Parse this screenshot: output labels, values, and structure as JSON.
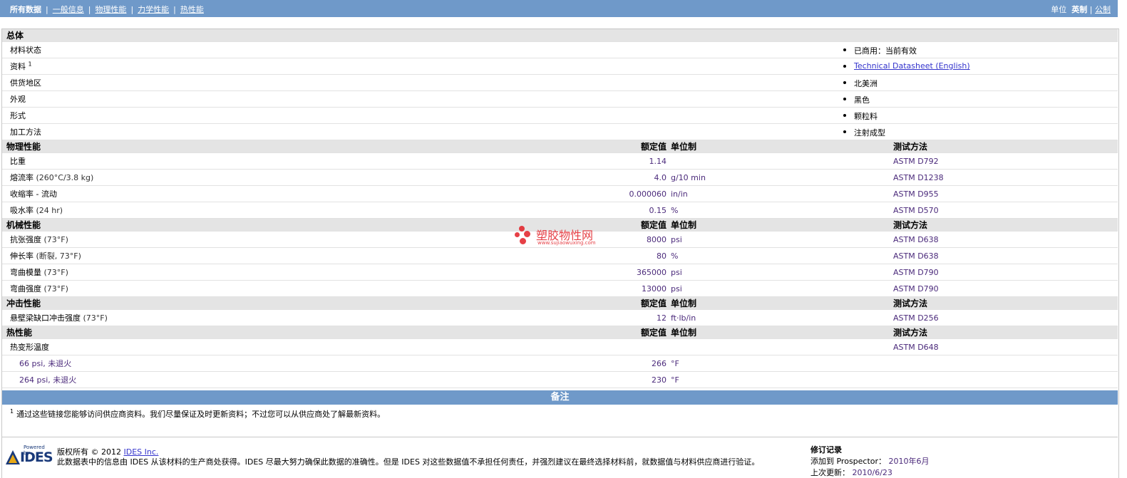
{
  "nav": {
    "items": [
      "所有数据",
      "一般信息",
      "物理性能",
      "力学性能",
      "热性能"
    ]
  },
  "units": {
    "label": "单位",
    "english": "英制",
    "metric": "公制"
  },
  "general": {
    "title": "总体",
    "rows": [
      {
        "label": "材料状态",
        "value": "已商用：当前有效"
      },
      {
        "label": "资料",
        "sup": "1",
        "value": "Technical Datasheet (English)"
      },
      {
        "label": "供货地区",
        "value": "北美洲"
      },
      {
        "label": "外观",
        "value": "黑色"
      },
      {
        "label": "形式",
        "value": "颗粒料"
      },
      {
        "label": "加工方法",
        "value": "注射成型"
      }
    ]
  },
  "headers": {
    "nominal": "额定值",
    "unit": "单位制",
    "method": "测试方法"
  },
  "physical": {
    "title": "物理性能",
    "rows": [
      {
        "label": "比重",
        "cond": "",
        "value": "1.14",
        "unit": "",
        "method": "ASTM D792"
      },
      {
        "label": "熔流率",
        "cond": "(260°C/3.8 kg)",
        "value": "4.0",
        "unit": "g/10 min",
        "method": "ASTM D1238"
      },
      {
        "label": "收缩率",
        "cond": "- 流动",
        "value": "0.000060",
        "unit": "in/in",
        "method": "ASTM D955"
      },
      {
        "label": "吸水率",
        "cond": "(24 hr)",
        "value": "0.15",
        "unit": "%",
        "method": "ASTM D570"
      }
    ]
  },
  "mechanical": {
    "title": "机械性能",
    "rows": [
      {
        "label": "抗张强度",
        "cond": "(73°F)",
        "value": "8000",
        "unit": "psi",
        "method": "ASTM D638"
      },
      {
        "label": "伸长率",
        "cond": "(断裂, 73°F)",
        "value": "80",
        "unit": "%",
        "method": "ASTM D638"
      },
      {
        "label": "弯曲模量",
        "cond": "(73°F)",
        "value": "365000",
        "unit": "psi",
        "method": "ASTM D790"
      },
      {
        "label": "弯曲强度",
        "cond": "(73°F)",
        "value": "13000",
        "unit": "psi",
        "method": "ASTM D790"
      }
    ]
  },
  "impact": {
    "title": "冲击性能",
    "rows": [
      {
        "label": "悬壁梁缺口冲击强度",
        "cond": "(73°F)",
        "value": "12",
        "unit": "ft·lb/in",
        "method": "ASTM D256"
      }
    ]
  },
  "thermal": {
    "title": "热性能",
    "rows": [
      {
        "label": "热变形温度",
        "cond": "",
        "value": "",
        "unit": "",
        "method": "ASTM D648"
      },
      {
        "label": "66 psi, 未退火",
        "cond": "",
        "value": "266",
        "unit": "°F",
        "method": ""
      },
      {
        "label": "264 psi, 未退火",
        "cond": "",
        "value": "230",
        "unit": "°F",
        "method": ""
      }
    ]
  },
  "notes": {
    "title": "备注",
    "footnote_num": "1",
    "footnote": "通过这些链接您能够访问供应商资料。我们尽量保证及时更新资料；不过您可以从供应商处了解最新资料。"
  },
  "footer": {
    "logo_top": "Powered by",
    "logo_word": "IDES",
    "copyright": "版权所有  © 2012",
    "company": "IDES Inc.",
    "disclaimer": "此数据表中的信息由  IDES 从该材料的生产商处获得。IDES 尽最大努力确保此数据的准确性。但是  IDES 对这些数据值不承担任何责任，并强烈建议在最终选择材料前，就数据值与材料供应商进行验证。",
    "rev_title": "修订记录",
    "added_label": "添加到 Prospector：",
    "added_value": "2010年6月",
    "updated_label": "上次更新：",
    "updated_value": "2010/6/23"
  },
  "watermark": {
    "name": "塑胶物性网",
    "url": "www.sujiaowuxing.com"
  },
  "colors": {
    "bar": "#6f99c9",
    "section": "#e4e4e4",
    "value": "#4b2a7b",
    "link": "#3333cc"
  }
}
